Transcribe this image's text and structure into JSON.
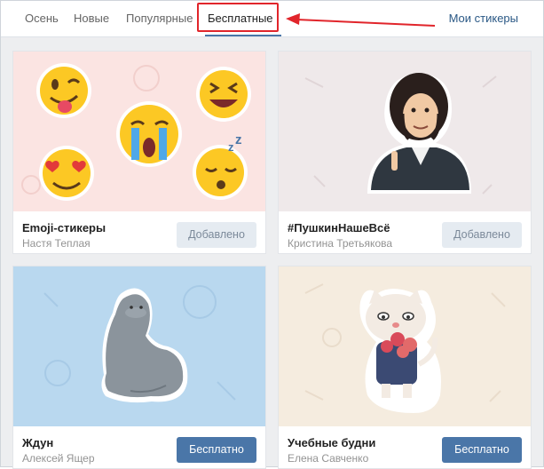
{
  "tabs": [
    {
      "label": "Осень"
    },
    {
      "label": "Новые"
    },
    {
      "label": "Популярные"
    },
    {
      "label": "Бесплатные",
      "active": true
    }
  ],
  "my_stickers_label": "Мои стикеры",
  "colors": {
    "accent": "#4a76a8",
    "highlight": "#e1252b"
  },
  "packs": [
    {
      "title": "Emoji-стикеры",
      "author": "Настя Теплая",
      "button": "Добавлено",
      "state": "added",
      "preview_icon": "emoji-faces"
    },
    {
      "title": "#ПушкинНашеВсё",
      "author": "Кристина Третьякова",
      "button": "Добавлено",
      "state": "added",
      "preview_icon": "pushkin-sticker"
    },
    {
      "title": "Ждун",
      "author": "Алексей Ящер",
      "button": "Бесплатно",
      "state": "free",
      "preview_icon": "zhdun-sticker"
    },
    {
      "title": "Учебные будни",
      "author": "Елена Савченко",
      "button": "Бесплатно",
      "state": "free",
      "preview_icon": "cat-student-sticker"
    }
  ]
}
